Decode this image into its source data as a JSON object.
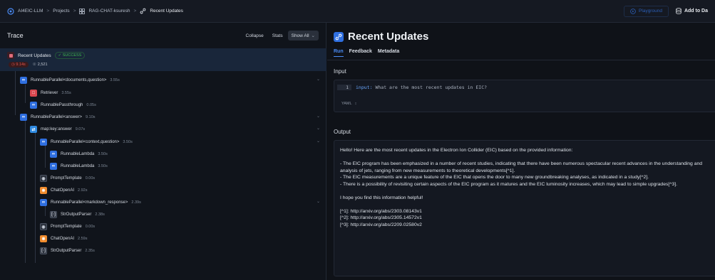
{
  "breadcrumb": {
    "org": "AI4EIC-LLM",
    "projects": "Projects",
    "project": "RAG-CHAT-ksuresh",
    "current": "Recent Updates"
  },
  "topbar": {
    "playground_label": "Playground",
    "add_dataset_label": "Add to Da"
  },
  "trace": {
    "title": "Trace",
    "collapse_label": "Collapse",
    "stats_label": "Stats",
    "showall_label": "Show All",
    "root": {
      "name": "Recent Updates",
      "status": "SUCCESS",
      "latency": "9.14s",
      "tokens": "2,521"
    },
    "nodes": [
      {
        "name": "RunnableParallel<documents,question>",
        "latency": "3.55s"
      },
      {
        "name": "Retriever",
        "latency": "3.55s"
      },
      {
        "name": "RunnablePassthrough",
        "latency": "0.05s"
      },
      {
        "name": "RunnableParallel<answer>",
        "latency": "9.10s"
      },
      {
        "name": "map:key:answer",
        "latency": "9.07s"
      },
      {
        "name": "RunnableParallel<context,question>",
        "latency": "3.50s"
      },
      {
        "name": "RunnableLambda",
        "latency": "3.50s"
      },
      {
        "name": "RunnableLambda",
        "latency": "3.50s"
      },
      {
        "name": "PromptTemplate",
        "latency": "0.00s"
      },
      {
        "name": "ChatOpenAI",
        "latency": "2.92s"
      },
      {
        "name": "RunnableParallel<markdown_response>",
        "latency": "2.39s"
      },
      {
        "name": "StrOutputParser",
        "latency": "2.38s"
      },
      {
        "name": "PromptTemplate",
        "latency": "0.00s"
      },
      {
        "name": "ChatOpenAI",
        "latency": "2.59s"
      },
      {
        "name": "StrOutputParser",
        "latency": "2.35s"
      }
    ]
  },
  "detail": {
    "title": "Recent Updates",
    "tabs": [
      "Run",
      "Feedback",
      "Metadata"
    ],
    "input_label": "Input",
    "input": {
      "line_number": "1",
      "key": "input:",
      "value": "What are the most recent updates in EIC?",
      "format": "YAML"
    },
    "output_label": "Output",
    "output": {
      "intro": "Hello! Here are the most recent updates in the Electron Ion Collider (EIC) based on the provided information:",
      "point1": "- The EIC program has been emphasized in a number of recent studies, indicating that there have been numerous spectacular recent advances in the understanding and analysis of jets, ranging from new measurements to theoretical developments[^1].",
      "point2": "- The EIC measurements are a unique feature of the EIC that opens the door to many new groundbreaking analyses, as indicated in a study[^2].",
      "point3": "- There is a possibility of revisiting certain aspects of the EIC program as it matures and the EIC luminosity increases, which may lead to simple upgrades[^3].",
      "closing": "I hope you find this information helpful!",
      "ref1": "[^1]: http://arxiv.org/abs/2303.08143v1",
      "ref2": "[^2]: http://arxiv.org/abs/2305.14572v1",
      "ref3": "[^3]: http://arxiv.org/abs/2209.02580v2"
    }
  },
  "colors": {
    "accent": "#2f6fe0",
    "success": "#3fb950",
    "error_badge": "#e0564e",
    "retriever": "#d9474f",
    "llm": "#f08c2e"
  }
}
